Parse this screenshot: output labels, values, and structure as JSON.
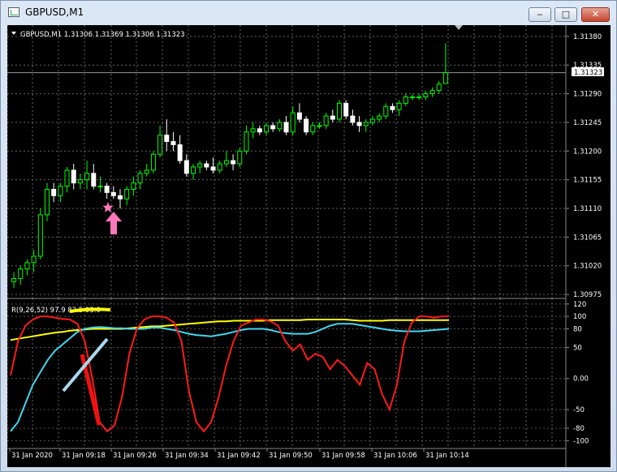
{
  "window": {
    "title": "GBPUSD,M1",
    "min_label": "‒",
    "max_label": "□",
    "close_label": "✕"
  },
  "price_pane": {
    "header": "GBPUSD,M1  1.31306 1.31369 1.31306 1.31323",
    "y_ticks": [
      "1.31380",
      "1.31335",
      "1.31290",
      "1.31245",
      "1.31200",
      "1.31155",
      "1.31110",
      "1.31065",
      "1.31020",
      "1.30975"
    ],
    "y_tick_values": [
      1.3138,
      1.31335,
      1.3129,
      1.31245,
      1.312,
      1.31155,
      1.3111,
      1.31065,
      1.3102,
      1.30975
    ],
    "current_price_label": "1.31323",
    "current_price": 1.31323,
    "candle_up_color": "#00ff00",
    "candle_down_color": "#ffffff",
    "star_color": "#ff77bb",
    "arrow_color": "#ff77bb"
  },
  "indicator_pane": {
    "header": "R(9,26,52) 97.9 82.5 93.0",
    "y_ticks": [
      "120",
      "100",
      "80",
      "50",
      "0.00",
      "-50",
      "-80",
      "-100"
    ],
    "y_tick_values": [
      120,
      100,
      80,
      50,
      0,
      -50,
      -80,
      -100
    ],
    "fast_color": "#ff1a1a",
    "mid_color": "#44d6ee",
    "slow_color": "#ffff00"
  },
  "x_axis": {
    "labels": [
      "31 Jan 2020",
      "31 Jan 09:18",
      "31 Jan 09:26",
      "31 Jan 09:34",
      "31 Jan 09:42",
      "31 Jan 09:50",
      "31 Jan 09:58",
      "31 Jan 10:06",
      "31 Jan 10:14"
    ]
  },
  "chart_data": {
    "type": "candlestick",
    "symbol": "GBPUSD",
    "timeframe": "M1",
    "ylim": [
      1.3097,
      1.3139
    ],
    "ohlc": [
      [
        1.30995,
        1.3101,
        1.30985,
        1.31
      ],
      [
        1.31,
        1.3102,
        1.3099,
        1.31015
      ],
      [
        1.31015,
        1.3103,
        1.31005,
        1.31025
      ],
      [
        1.31025,
        1.31045,
        1.3101,
        1.31035
      ],
      [
        1.31035,
        1.3111,
        1.3103,
        1.311
      ],
      [
        1.311,
        1.3115,
        1.3109,
        1.3114
      ],
      [
        1.3114,
        1.3115,
        1.3112,
        1.3113
      ],
      [
        1.3113,
        1.3115,
        1.3112,
        1.31145
      ],
      [
        1.31145,
        1.31175,
        1.31135,
        1.3117
      ],
      [
        1.3117,
        1.3118,
        1.3114,
        1.3115
      ],
      [
        1.3115,
        1.31165,
        1.3114,
        1.31155
      ],
      [
        1.31155,
        1.31185,
        1.3114,
        1.31165
      ],
      [
        1.31165,
        1.3118,
        1.3114,
        1.31145
      ],
      [
        1.31145,
        1.3116,
        1.31135,
        1.31145
      ],
      [
        1.31145,
        1.3115,
        1.31125,
        1.31135
      ],
      [
        1.31135,
        1.31145,
        1.31125,
        1.3113
      ],
      [
        1.3113,
        1.3114,
        1.3111,
        1.31125
      ],
      [
        1.31125,
        1.31145,
        1.31115,
        1.3114
      ],
      [
        1.3114,
        1.3116,
        1.3113,
        1.3115
      ],
      [
        1.3115,
        1.3117,
        1.3114,
        1.31165
      ],
      [
        1.31165,
        1.3118,
        1.3116,
        1.3117
      ],
      [
        1.3117,
        1.312,
        1.31165,
        1.31195
      ],
      [
        1.31195,
        1.3124,
        1.3119,
        1.31225
      ],
      [
        1.31225,
        1.3125,
        1.312,
        1.31215
      ],
      [
        1.31215,
        1.3123,
        1.312,
        1.3121
      ],
      [
        1.3121,
        1.31225,
        1.3118,
        1.31185
      ],
      [
        1.31185,
        1.31195,
        1.3116,
        1.31165
      ],
      [
        1.31165,
        1.3118,
        1.31155,
        1.31175
      ],
      [
        1.31175,
        1.31185,
        1.31165,
        1.3118
      ],
      [
        1.3118,
        1.31185,
        1.3117,
        1.31175
      ],
      [
        1.31175,
        1.3119,
        1.31165,
        1.3117
      ],
      [
        1.3117,
        1.31185,
        1.31165,
        1.3118
      ],
      [
        1.3118,
        1.312,
        1.31175,
        1.31185
      ],
      [
        1.31185,
        1.31195,
        1.3117,
        1.3118
      ],
      [
        1.3118,
        1.31205,
        1.31175,
        1.312
      ],
      [
        1.312,
        1.3124,
        1.31195,
        1.3123
      ],
      [
        1.3123,
        1.31245,
        1.3122,
        1.31235
      ],
      [
        1.31235,
        1.3124,
        1.31225,
        1.3123
      ],
      [
        1.3123,
        1.31245,
        1.31225,
        1.3124
      ],
      [
        1.3124,
        1.31245,
        1.3123,
        1.31235
      ],
      [
        1.31235,
        1.3125,
        1.3123,
        1.31245
      ],
      [
        1.31245,
        1.31255,
        1.31225,
        1.3123
      ],
      [
        1.3123,
        1.3127,
        1.31225,
        1.3126
      ],
      [
        1.3126,
        1.31275,
        1.31245,
        1.3125
      ],
      [
        1.3125,
        1.31255,
        1.31225,
        1.3123
      ],
      [
        1.3123,
        1.31245,
        1.31225,
        1.3124
      ],
      [
        1.3124,
        1.31245,
        1.31235,
        1.3124
      ],
      [
        1.3124,
        1.3126,
        1.31235,
        1.31255
      ],
      [
        1.31255,
        1.31265,
        1.31245,
        1.3125
      ],
      [
        1.3125,
        1.3128,
        1.31245,
        1.31275
      ],
      [
        1.31275,
        1.3128,
        1.3125,
        1.31255
      ],
      [
        1.31255,
        1.31265,
        1.3124,
        1.31245
      ],
      [
        1.31245,
        1.31255,
        1.3123,
        1.3124
      ],
      [
        1.3124,
        1.3125,
        1.3123,
        1.31245
      ],
      [
        1.31245,
        1.31255,
        1.3124,
        1.3125
      ],
      [
        1.3125,
        1.3126,
        1.31245,
        1.31255
      ],
      [
        1.31255,
        1.31275,
        1.3125,
        1.3127
      ],
      [
        1.3127,
        1.31275,
        1.3126,
        1.31265
      ],
      [
        1.31265,
        1.3128,
        1.31255,
        1.31275
      ],
      [
        1.31275,
        1.3129,
        1.3127,
        1.31285
      ],
      [
        1.31285,
        1.3129,
        1.3128,
        1.31285
      ],
      [
        1.31285,
        1.3129,
        1.3128,
        1.31285
      ],
      [
        1.31285,
        1.31295,
        1.3128,
        1.3129
      ],
      [
        1.3129,
        1.313,
        1.31285,
        1.31295
      ],
      [
        1.31295,
        1.3131,
        1.3129,
        1.31305
      ],
      [
        1.31306,
        1.31369,
        1.31306,
        1.31323
      ]
    ],
    "indicator": {
      "name": "R(9,26,52)",
      "values_last": [
        97.9,
        82.5,
        93.0
      ],
      "ylim": [
        -110,
        125
      ],
      "fast": [
        5,
        60,
        85,
        95,
        100,
        100,
        98,
        96,
        95,
        88,
        60,
        0,
        -70,
        -85,
        -75,
        -30,
        40,
        80,
        95,
        100,
        100,
        98,
        90,
        60,
        -20,
        -70,
        -85,
        -70,
        -30,
        20,
        60,
        85,
        90,
        95,
        95,
        92,
        85,
        60,
        45,
        55,
        30,
        40,
        35,
        15,
        30,
        20,
        5,
        -10,
        25,
        15,
        -25,
        -50,
        -10,
        60,
        90,
        100,
        100,
        98,
        100,
        100
      ],
      "mid": [
        -85,
        -70,
        -40,
        -10,
        10,
        30,
        45,
        55,
        65,
        75,
        80,
        82,
        83,
        82,
        81,
        81,
        80,
        80,
        80,
        82,
        82,
        80,
        78,
        75,
        72,
        70,
        69,
        68,
        70,
        72,
        75,
        78,
        80,
        80,
        80,
        78,
        75,
        73,
        72,
        72,
        72,
        75,
        80,
        85,
        88,
        88,
        88,
        86,
        84,
        82,
        80,
        78,
        77,
        76,
        76,
        76,
        77,
        78,
        79,
        80
      ],
      "slow": [
        62,
        64,
        66,
        68,
        70,
        72,
        74,
        75,
        77,
        78,
        79,
        80,
        80,
        80,
        80,
        80,
        81,
        82,
        83,
        84,
        84,
        85,
        86,
        87,
        88,
        89,
        90,
        91,
        92,
        92,
        93,
        93,
        93,
        93,
        93,
        94,
        94,
        94,
        94,
        94,
        95,
        95,
        95,
        95,
        95,
        95,
        94,
        93,
        93,
        93,
        93,
        94,
        94,
        94,
        94,
        94,
        94,
        94,
        94,
        94
      ]
    }
  }
}
